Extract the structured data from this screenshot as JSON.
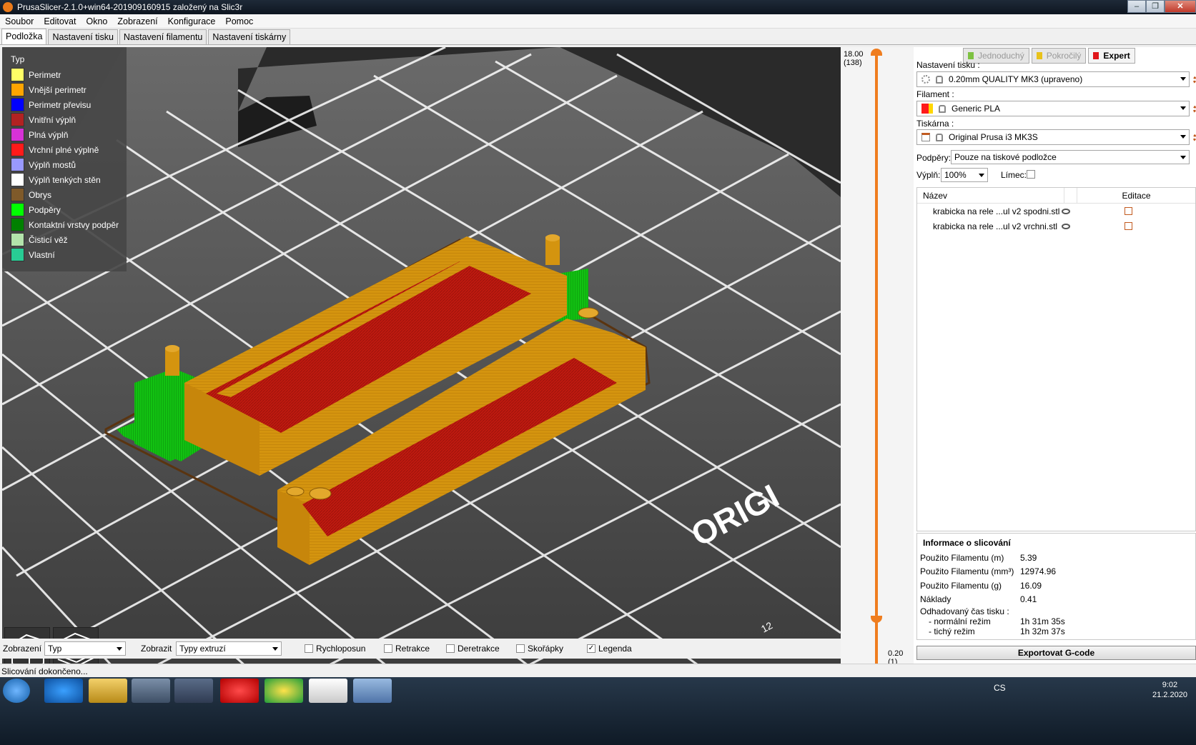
{
  "window": {
    "title": "PrusaSlicer-2.1.0+win64-201909160915 založený na Slic3r",
    "controls": [
      "–",
      "❐",
      "✕"
    ]
  },
  "menu": [
    "Soubor",
    "Editovat",
    "Okno",
    "Zobrazení",
    "Konfigurace",
    "Pomoc"
  ],
  "tabs": [
    "Podložka",
    "Nastavení tisku",
    "Nastavení filamentu",
    "Nastavení tiskárny"
  ],
  "legend": {
    "title": "Typ",
    "items": [
      {
        "label": "Perimetr",
        "color": "#ffff66"
      },
      {
        "label": "Vnější perimetr",
        "color": "#ffa500"
      },
      {
        "label": "Perimetr převisu",
        "color": "#0000ff"
      },
      {
        "label": "Vnitřní výplň",
        "color": "#b22222"
      },
      {
        "label": "Plná výplň",
        "color": "#d732d7"
      },
      {
        "label": "Vrchní plné výplně",
        "color": "#ff1a1a"
      },
      {
        "label": "Výplň mostů",
        "color": "#9999ff"
      },
      {
        "label": "Výplň tenkých stěn",
        "color": "#ffffff"
      },
      {
        "label": "Obrys",
        "color": "#7f5a2a"
      },
      {
        "label": "Podpěry",
        "color": "#00ff00"
      },
      {
        "label": "Kontaktní vrstvy podpěr",
        "color": "#008000"
      },
      {
        "label": "Čisticí věž",
        "color": "#b3e3ab"
      },
      {
        "label": "Vlastní",
        "color": "#28cc94"
      }
    ]
  },
  "layer_slider": {
    "top_value": "18.00",
    "top_layer": "(138)",
    "bottom_value": "0.20",
    "bottom_layer": "(1)"
  },
  "bed_text": "ORIGI",
  "bed_corner_number": "12",
  "mode_buttons": [
    {
      "label": "Jednoduchý",
      "color": "#7ec242"
    },
    {
      "label": "Pokročilý",
      "color": "#e8c21a"
    },
    {
      "label": "Expert",
      "color": "#e0161a"
    }
  ],
  "print_settings": {
    "label": "Nastavení tisku :",
    "value": "0.20mm QUALITY MK3 (upraveno)"
  },
  "filament": {
    "label": "Filament :",
    "value": "Generic PLA",
    "swatch_colors": [
      "#ff1a1a",
      "#ffd700"
    ]
  },
  "printer": {
    "label": "Tiskárna :",
    "value": "Original Prusa i3 MK3S"
  },
  "supports": {
    "label": "Podpěry:",
    "value": "Pouze na tiskové podložce"
  },
  "infill": {
    "label": "Výplň:",
    "value": "100%",
    "brim_label": "Límec:"
  },
  "object_list": {
    "col_name": "Název",
    "col_edit": "Editace",
    "objects": [
      "krabicka na rele ...ul v2 spodni.stl",
      "krabicka na rele ...ul v2 vrchni.stl"
    ]
  },
  "slice_info": {
    "title": "Informace o slicování",
    "rows": [
      {
        "k": "Použito Filamentu (m)",
        "v": "5.39"
      },
      {
        "k": "Použito Filamentu (mm³)",
        "v": "12974.96"
      },
      {
        "k": "Použito Filamentu (g)",
        "v": "16.09"
      },
      {
        "k": "Náklady",
        "v": "0.41"
      }
    ],
    "time_label": "Odhadovaný čas tisku :",
    "normal_label": "- normální režim",
    "normal_value": "1h 31m 35s",
    "silent_label": "- tichý režim",
    "silent_value": "1h 32m 37s"
  },
  "export_button": "Exportovat G-code",
  "bottom_toolbar": {
    "view_label": "Zobrazení",
    "view_value": "Typ",
    "show_label": "Zobrazit",
    "show_value": "Typy extruzí",
    "checks": [
      {
        "label": "Rychloposun",
        "checked": false
      },
      {
        "label": "Retrakce",
        "checked": false
      },
      {
        "label": "Deretrakce",
        "checked": false
      },
      {
        "label": "Skořápky",
        "checked": false
      },
      {
        "label": "Legenda",
        "checked": true
      }
    ]
  },
  "status": "Slicování dokončeno...",
  "taskbar": {
    "lang": "CS",
    "time": "9:02",
    "date": "21.2.2020"
  }
}
